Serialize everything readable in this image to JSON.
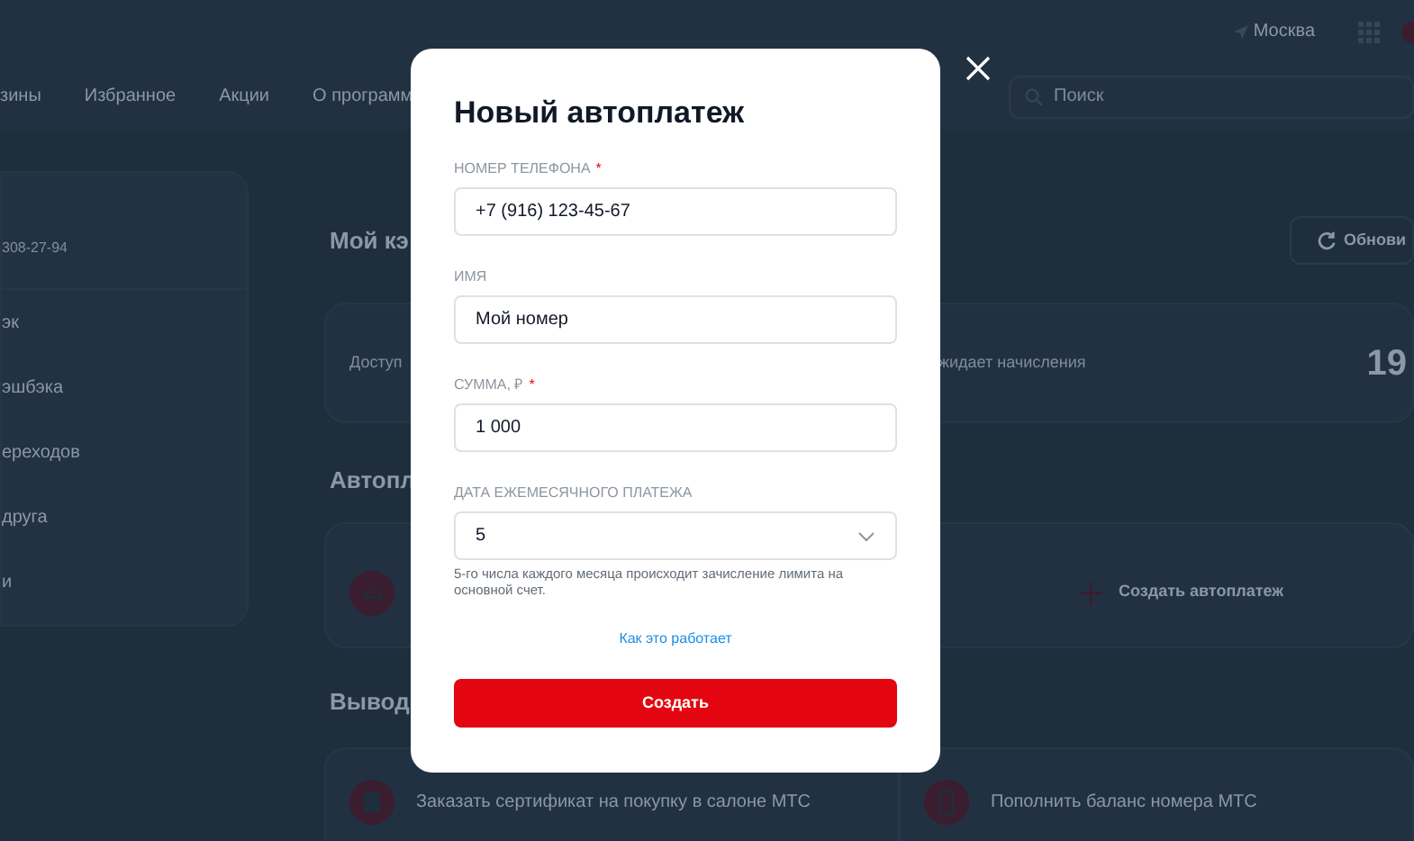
{
  "header": {
    "city": "Москва"
  },
  "nav": {
    "items": [
      "зины",
      "Избранное",
      "Акции",
      "О программ"
    ],
    "search": {
      "placeholder": "Поиск"
    }
  },
  "sidebar": {
    "phone": "308-27-94",
    "items": [
      "эк",
      "эшбэка",
      "ереходов",
      "друга",
      "и"
    ]
  },
  "cashback": {
    "title": "Мой кэ",
    "refresh": "Обнови",
    "available": "Доступ",
    "pending": "жидает начисления",
    "value": "19"
  },
  "autopay": {
    "title": "Автопл",
    "create": "Создать автоплатеж"
  },
  "withdraw": {
    "title": "Вывод",
    "options": [
      {
        "kind": "certificate",
        "label": "Заказать сертификат на покупку в салоне МТС"
      },
      {
        "kind": "phone",
        "label": "Пополнить баланс номера МТС"
      }
    ]
  },
  "modal": {
    "title": "Новый автоплатеж",
    "fields": [
      {
        "kind": "input",
        "label": "НОМЕР ТЕЛЕФОНА",
        "required_mark": "*",
        "value": "+7 (916) 123-45-67"
      },
      {
        "kind": "input",
        "label": "ИМЯ",
        "value": "Мой номер"
      },
      {
        "kind": "input",
        "label": "СУММА, ₽",
        "required_mark": "*",
        "value": "1 000"
      },
      {
        "kind": "select",
        "label": "ДАТА ЕЖЕМЕСЯЧНОГО ПЛАТЕЖА",
        "value": "5",
        "hint": "5-го числа каждого месяца происходит зачисление лимита на основной счет."
      }
    ],
    "link": "Как это работает",
    "submit": "Создать"
  }
}
